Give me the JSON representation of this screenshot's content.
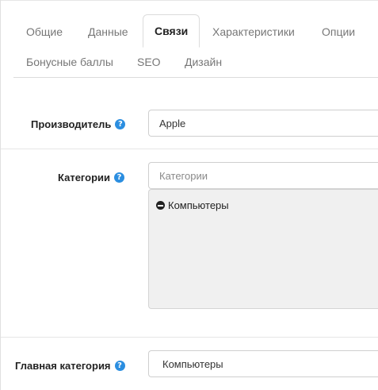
{
  "tabs": [
    {
      "label": "Общие",
      "active": false
    },
    {
      "label": "Данные",
      "active": false
    },
    {
      "label": "Связи",
      "active": true
    },
    {
      "label": "Характеристики",
      "active": false
    },
    {
      "label": "Опции",
      "active": false
    },
    {
      "label": "Бонусные баллы",
      "active": false
    },
    {
      "label": "SEO",
      "active": false
    },
    {
      "label": "Дизайн",
      "active": false
    }
  ],
  "manufacturer": {
    "label": "Производитель",
    "value": "Apple"
  },
  "categories": {
    "label": "Категории",
    "placeholder": "Категории",
    "selected": [
      "Компьютеры"
    ]
  },
  "main_category": {
    "label": "Главная категория",
    "value": "Компьютеры"
  },
  "help_glyph": "?",
  "colors": {
    "help_icon": "#2b8ee0",
    "category_box_bg": "#f0f0f0"
  }
}
